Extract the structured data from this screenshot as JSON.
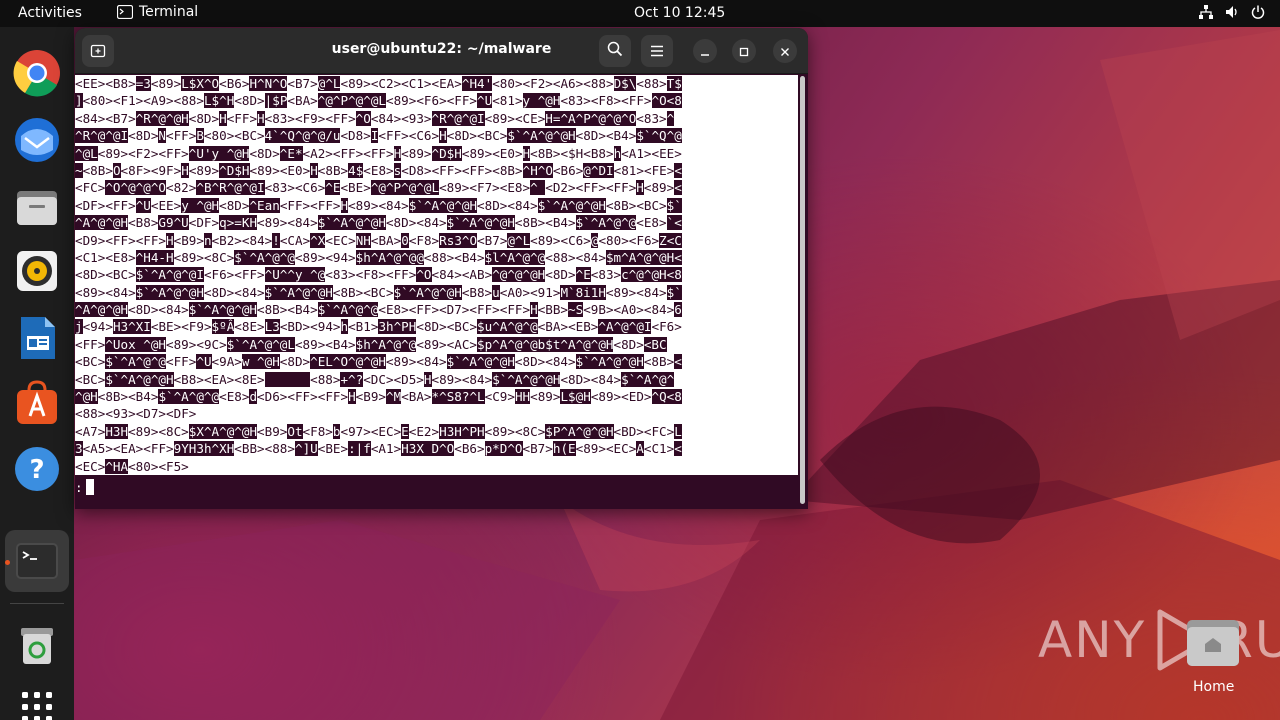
{
  "topbar": {
    "activities": "Activities",
    "app_name": "Terminal",
    "clock": "Oct 10  12:45"
  },
  "dock": {
    "items": [
      {
        "name": "chrome-icon"
      },
      {
        "name": "thunderbird-icon"
      },
      {
        "name": "files-icon"
      },
      {
        "name": "rhythmbox-icon"
      },
      {
        "name": "writer-icon"
      },
      {
        "name": "app-center-icon"
      },
      {
        "name": "help-icon"
      },
      {
        "name": "terminal-icon"
      },
      {
        "name": "trash-icon"
      },
      {
        "name": "show-apps-icon"
      }
    ]
  },
  "terminal": {
    "title": "user@ubuntu22: ~/malware",
    "lines": [
      "<EE><B8>=3<89>L$X^O<B6>H^N^O<B7>@^L<89><C2><C1><EA>^H4'<80><F2><A6><88>D$\\<88>T$",
      "]<80><F1><A9><88>L$^H<8D>|$P<BA>^@^P^@^@L<89><F6><FF>^U<81>y ^@H<83><F8><FF>^O<8",
      "<84><B7>^R^@^@H<8D>H<FF>H<83><F9><FF>^O<84><93>^R^@^@I<89><CE>H=^A^P^@^@^O<83>^",
      "^R^@^@I<8D>N<FF>B<80><BC>4`^Q^@^@/u<D8>I<FF><C6>H<8D><BC>$`^A^@^@H<8D><B4>$`^Q^@",
      "^@L<89><F2><FF>^U'y ^@H<8D>^E*<A2><FF><FF>H<89>^D$H<89><E0>H<8B><$H<B8>h<A1><EE>",
      "~<8B>O<8F><9F>H<89>^D$H<89><E0>H<8B>4$<E8>s<D8><FF><FF><8B>^H^O<B6>@^DI<81><FE><",
      "<FC>^O^@^@^O<82>^B^R^@^@I<83><C6>^E<BE>^@^P^@^@L<89><F7><E8>^ <D2><FF><FF>H<89><",
      "<DF><FF>^U<EE>y ^@H<8D>^Ean<FF><FF>H<89><84>$`^A^@^@H<8D><84>$`^A^@^@H<8B><BC>$`",
      "^A^@^@H<B8>G9^U<DF>q>=KH<89><84>$`^A^@^@H<8D><84>$`^A^@^@H<8B><B4>$`^A^@^@<E8>`<",
      "<D9><FF><FF>H<B9>n<B2><84>!<CA>^X<EC>NH<BA>0<F8>Rs3^O<B7>@^L<89><C6>@<80><F6>Z<C",
      "<C1><E8>^H4-H<89><8C>$`^A^@^@<89><94>$h^A^@^@@<88><B4>$l^A^@^@<88><84>$m^A^@^@H<",
      "<8D><BC>$`^A^@^@I<F6><FF>^U^^y ^@<83><F8><FF>^O<84><AB>^@^@^@H<8D>^E<83>c^@^@H<8",
      "<89><84>$`^A^@^@H<8D><84>$`^A^@^@H<8B><BC>$`^A^@^@H<B8>u<A0><91>M`8i1H<89><84>$`",
      "^A^@^@H<8D><84>$`^A^@^@H<8B><B4>$`^A^@^@<E8><FF><D7><FF><FF>H<BB>~S<9B><A0><84>6",
      "j<94>H3^XI<BE><F9>$ºÂ<8E>L3<BD><94>h<B1>3h^PH<8D><BC>$u^A^@^@<BA><EB>^A^@^@I<F6>",
      "<FF>^Uox ^@H<89><9C>$`^A^@^@L<89><B4>$h^A^@^@<89><AC>$p^A^@^@b$t^A^@^@H<8D><BC",
      "<BC>$`^A^@^@<FF>^U<9A>w ^@H<8D>^EL^O^@^@H<89><84>$`^A^@^@H<8D><84>$`^A^@^@H<8B><",
      "<BC>$`^A^@^@H<B8><EA><8E>      <88>+^?<DC><D5>H<89><84>$`^A^@^@H<8D><84>$`^A^@^",
      "^@H<8B><B4>$`^A^@^@<E8>d<D6><FF><FF>H<B9>^M<BA>*^S8?^L<C9>HH<89>L$@H<89><ED>^Q<8",
      "<88><93><D7><DF>",
      "<A7>H3H<89><8C>$X^A^@^@H<B9>Ot<F8>b<97><EC>E<E2>H3H^PH<89><8C>$P^A^@^@H<BD><FC>L",
      "3<A5><EA><FF>9YH3h^XH<BB><88>^]U<BE>:|f<A1>H3X D^O<B6>p*D^O<B7>h(E<89><EC>A<C1><",
      "<EC>^HA<80><F5>"
    ],
    "prompt": ":"
  },
  "home": {
    "label": "Home"
  },
  "watermark": {
    "text_left": "ANY",
    "text_right": "RUN"
  }
}
